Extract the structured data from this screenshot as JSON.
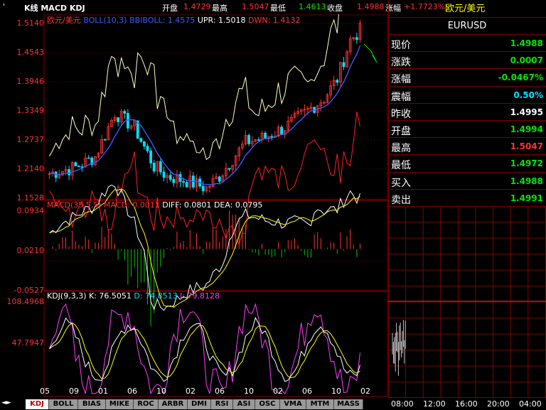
{
  "topbar": {
    "left_mark": "' ",
    "title": "K线 MACD KDJ",
    "open_label": "开盘",
    "open_value": "1.4729",
    "high_label": "最高",
    "high_value": "1.5047",
    "low_label": "最低",
    "low_value": "1.4613",
    "close_label": "收盘",
    "close_value": "1.4988",
    "change_label": "涨幅",
    "change_value": "+1.7723%",
    "pair_name": "欧元/美元"
  },
  "main_panel": {
    "legend_name": "欧元/美元",
    "legend_boll": "BOLL(10,3)",
    "legend_bbiboll": "BBIBOLL: 1.4575",
    "legend_upr": "UPR: 1.5018",
    "legend_dwn": "DWN: 1.4132",
    "y_ticks": [
      "1.5140",
      "1.4543",
      "1.3946",
      "1.3349",
      "1.2737",
      "1.2140",
      "1.1528"
    ]
  },
  "macd_panel": {
    "legend_title": "MACD(35,5,5)",
    "legend_macd": "MACD: 0.0011",
    "legend_diff": "DIFF: 0.0801",
    "legend_dea": "DEA: 0.0795",
    "y_ticks": [
      "0.0934",
      "0.0210",
      "-0.0527"
    ]
  },
  "kdj_panel": {
    "legend_title": "KDJ(9,3,3)",
    "legend_k": "K: 76.5051",
    "legend_d": "D: 74.8513",
    "legend_j": "J: 79.8128",
    "y_ticks": [
      "108.4968",
      "47.7947"
    ]
  },
  "x_axis": [
    "05",
    "09",
    "01",
    "06",
    "10",
    "02",
    "06",
    "10",
    "02",
    "06",
    "10",
    "02"
  ],
  "quote": {
    "symbol": "EURUSD",
    "rows": [
      {
        "label": "现价",
        "value": "1.4988",
        "color": "#00e600"
      },
      {
        "label": "涨跌",
        "value": "0.0007",
        "color": "#00e600"
      },
      {
        "label": "涨幅",
        "value": "-0.0467%",
        "color": "#00e600"
      },
      {
        "label": "震幅",
        "value": "0.50%",
        "color": "#00e0ff"
      },
      {
        "label": "昨收",
        "value": "1.4995",
        "color": "#ffffff"
      },
      {
        "label": "开盘",
        "value": "1.4994",
        "color": "#00e600"
      },
      {
        "label": "最高",
        "value": "1.5047",
        "color": "#ff3232"
      },
      {
        "label": "最低",
        "value": "1.4972",
        "color": "#00e600"
      },
      {
        "label": "买入",
        "value": "1.4988",
        "color": "#00e600"
      },
      {
        "label": "卖出",
        "value": "1.4991",
        "color": "#00e600"
      }
    ]
  },
  "tabs": [
    "KDJ",
    "BOLL",
    "BIAS",
    "MIKE",
    "ROC",
    "ARBR",
    "DMI",
    "RSI",
    "ASI",
    "OSC",
    "VMA",
    "MTM",
    "MASS"
  ],
  "active_tab": "KDJ",
  "tab_arrow": "◄►",
  "time_axis": [
    "08:00",
    "12:00",
    "16:00",
    "20:00",
    "04:00"
  ],
  "colors": {
    "up": "#ff3232",
    "down": "#00e0ff",
    "grid": "#800000",
    "boll_mid": "#3c5aff",
    "boll_upper": "#ffffc0",
    "boll_lower": "#ff2020",
    "diff": "#ffffff",
    "dea": "#ffff00",
    "k": "#ffffff",
    "d": "#ffff00",
    "j": "#ff3cff"
  }
}
